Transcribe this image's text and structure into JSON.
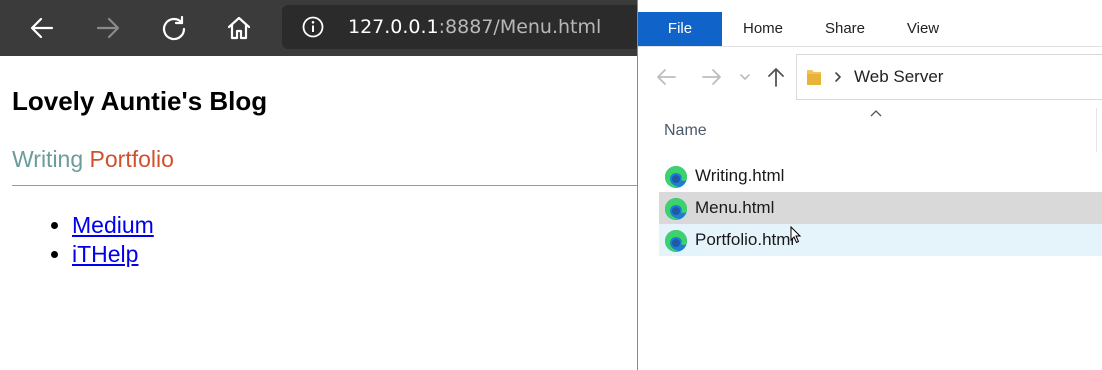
{
  "browser": {
    "url_host": "127.0.0.1",
    "url_path": ":8887/Menu.html",
    "page": {
      "title": "Lovely Auntie's Blog",
      "nav": {
        "writing": "Writing",
        "portfolio": "Portfolio"
      },
      "links": [
        {
          "label": "Medium"
        },
        {
          "label": "iTHelp"
        }
      ]
    }
  },
  "explorer": {
    "tabs": [
      "File",
      "Home",
      "Share",
      "View"
    ],
    "breadcrumb": "Web Server",
    "column_name": "Name",
    "files": [
      {
        "name": "Writing.html",
        "state": "normal"
      },
      {
        "name": "Menu.html",
        "state": "selected"
      },
      {
        "name": "Portfolio.html",
        "state": "hover"
      }
    ]
  },
  "colors": {
    "nav_writing": "#6a9c9c",
    "nav_portfolio": "#d2502e",
    "file_tab_bg": "#1063c9",
    "link": "#0000ee"
  }
}
